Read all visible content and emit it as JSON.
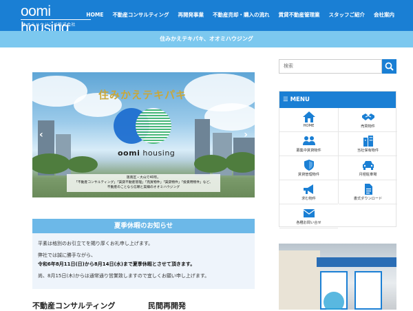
{
  "header": {
    "logo_text": "oomi housing",
    "logo_sub": "オオミハウジング株式会社",
    "nav": [
      "HOME",
      "不動産コンサルティング",
      "再開発事業",
      "不動産売却・購入の流れ",
      "賃貸不動産管理業",
      "スタッフご紹介",
      "会社案内"
    ]
  },
  "tagline": "住みかえテキパキ、オオミハウジング",
  "slider": {
    "catch": "住みかえテキパキ",
    "brand_word1": "oomi",
    "brand_word2": "housing",
    "caption": [
      "阪南区・大山で40年。",
      "「不動産コンサルティング」「賃貸不動産管理」「売買物件」「賃貸物件」「投資用物件」など、",
      "不動産のことなら信頼と実績のオオミハウジング"
    ],
    "prev_label": "‹",
    "next_label": "›"
  },
  "notice": {
    "title": "夏季休暇のお知らせ",
    "lines": [
      "平素は格別のお引立てを賜り厚くお礼申し上げます。",
      "弊社では誠に勝手ながら、",
      "令和6年8月11日(日)から8月14日(水)まで夏季休暇とさせて頂きます。",
      "尚、8月15日(木)からは通常通り営業致しますので宜しくお願い申し上げます。"
    ]
  },
  "sections": [
    "不動産コンサルティング",
    "民間再開発"
  ],
  "search": {
    "placeholder": "検索"
  },
  "menu": {
    "title": "MENU",
    "items": [
      {
        "label": "HOME",
        "icon": "home-icon"
      },
      {
        "label": "売買物件",
        "icon": "handshake-icon"
      },
      {
        "label": "募集中賃貸物件",
        "icon": "users-icon"
      },
      {
        "label": "当社保有物件",
        "icon": "building-icon"
      },
      {
        "label": "賃貸管理物件",
        "icon": "shield-icon"
      },
      {
        "label": "月極駐車場",
        "icon": "car-icon"
      },
      {
        "label": "求む物件",
        "icon": "megaphone-icon"
      },
      {
        "label": "書式ダウンロード",
        "icon": "document-icon"
      },
      {
        "label": "各種お問い合せ",
        "icon": "envelope-icon"
      }
    ]
  },
  "colors": {
    "brand": "#1a7fd4",
    "band": "#7cc8ef",
    "notice_head": "#6cb8e8"
  }
}
